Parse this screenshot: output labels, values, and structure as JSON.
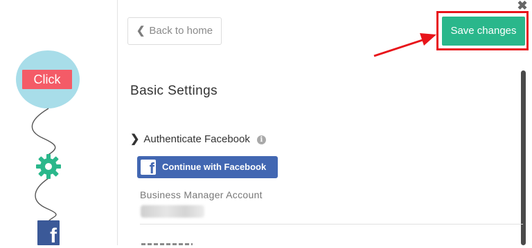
{
  "tutorial": {
    "click_label": "Click"
  },
  "header": {
    "back_label": "Back to home",
    "save_label": "Save changes",
    "close_glyph": "✖"
  },
  "main": {
    "title": "Basic Settings",
    "auth_label": "Authenticate Facebook",
    "fb_button_label": "Continue with Facebook",
    "business_manager_label": "Business Manager Account"
  },
  "colors": {
    "save_green": "#2ab78b",
    "highlight_red": "#e8141a",
    "facebook_blue": "#4267b2",
    "click_pink": "#f45b67",
    "circle_blue": "#a8dde9",
    "gear_teal": "#2ab78b"
  },
  "icons": [
    "chevron-left-icon",
    "close-icon",
    "chevron-right-icon",
    "info-icon",
    "facebook-icon",
    "gear-icon"
  ]
}
